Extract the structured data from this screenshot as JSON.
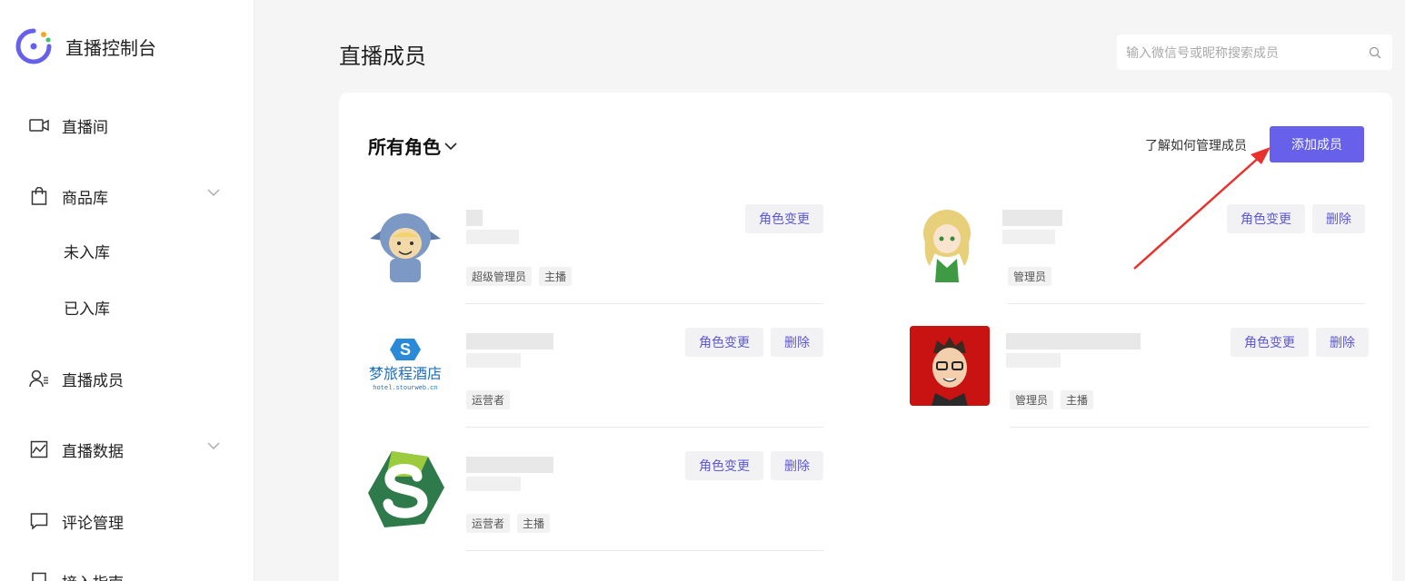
{
  "sidebar": {
    "brand_title": "直播控制台",
    "items": [
      {
        "label": "直播间",
        "icon": "video-camera-icon"
      },
      {
        "label": "商品库",
        "icon": "shopping-bag-icon"
      },
      {
        "label": "未入库"
      },
      {
        "label": "已入库"
      },
      {
        "label": "直播成员",
        "icon": "members-icon"
      },
      {
        "label": "直播数据",
        "icon": "chart-icon"
      },
      {
        "label": "评论管理",
        "icon": "comment-icon"
      },
      {
        "label": "接入指南",
        "icon": "guide-icon"
      }
    ]
  },
  "header": {
    "title": "直播成员",
    "search_placeholder": "输入微信号或昵称搜索成员"
  },
  "card": {
    "filter_label": "所有角色",
    "help_link": "了解如何管理成员",
    "add_button": "添加成员"
  },
  "actions": {
    "change_role": "角色变更",
    "delete": "删除"
  },
  "members": [
    {
      "tags": [
        "超级管理员",
        "主播"
      ],
      "can_delete": false
    },
    {
      "tags": [
        "管理员"
      ],
      "can_delete": true,
      "hotel_name": "梦旅程酒店",
      "hotel_url": "hotel.stourweb.cn"
    },
    {
      "tags": [
        "运营者"
      ],
      "can_delete": true
    },
    {
      "tags": [
        "管理员",
        "主播"
      ],
      "can_delete": true
    },
    {
      "tags": [
        "运营者",
        "主播"
      ],
      "can_delete": true
    }
  ],
  "colors": {
    "accent": "#6660ea",
    "annotation_arrow": "#e8322d"
  }
}
